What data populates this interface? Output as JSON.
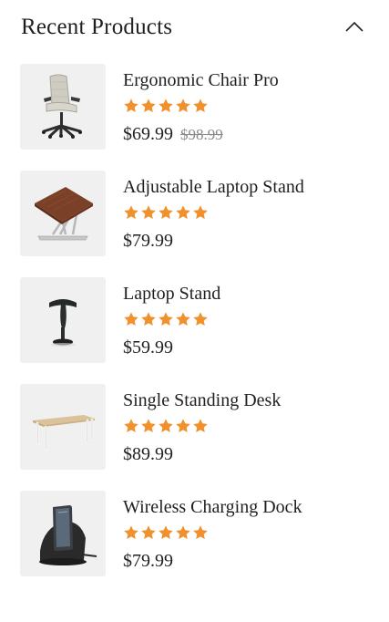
{
  "widget": {
    "title": "Recent Products",
    "toggle_icon": "chevron-up-icon",
    "star_color": "#f0912d"
  },
  "products": [
    {
      "name": "Ergonomic Chair Pro",
      "rating": 5,
      "price": "$69.99",
      "old_price": "$98.99",
      "image_icon": "office-chair-icon"
    },
    {
      "name": "Adjustable Laptop Stand",
      "rating": 5,
      "price": "$79.99",
      "old_price": "",
      "image_icon": "laptop-stand-icon"
    },
    {
      "name": "Laptop Stand",
      "rating": 5,
      "price": "$59.99",
      "old_price": "",
      "image_icon": "stool-stand-icon"
    },
    {
      "name": "Single Standing Desk",
      "rating": 5,
      "price": "$89.99",
      "old_price": "",
      "image_icon": "standing-desk-icon"
    },
    {
      "name": "Wireless Charging Dock",
      "rating": 5,
      "price": "$79.99",
      "old_price": "",
      "image_icon": "charging-dock-icon"
    }
  ]
}
